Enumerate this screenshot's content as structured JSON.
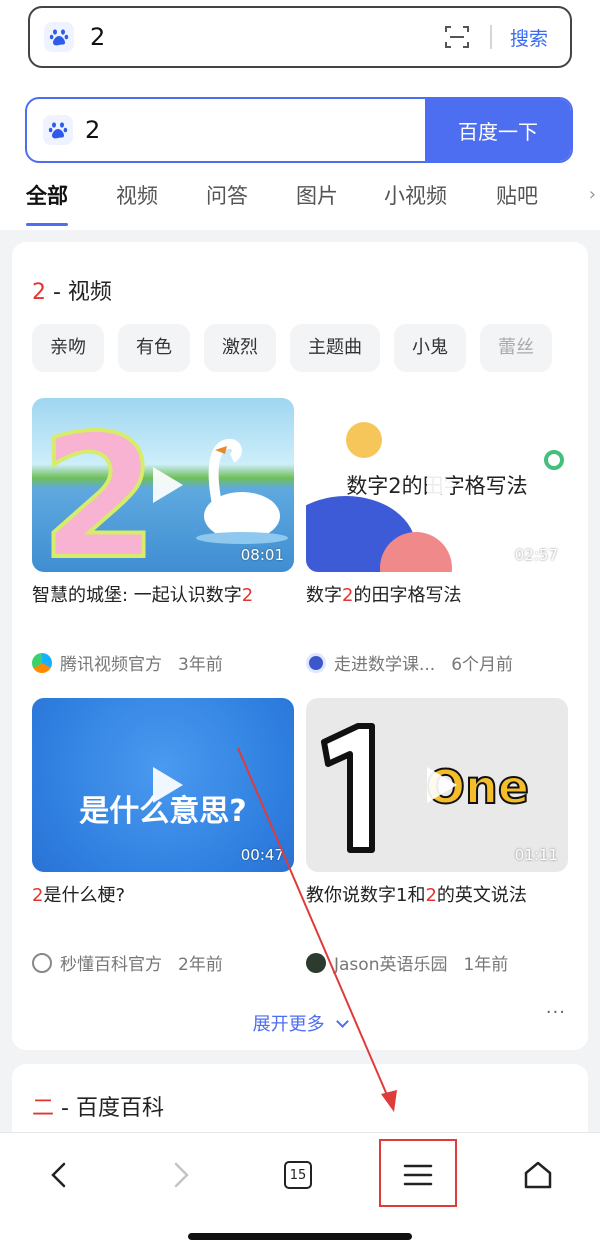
{
  "address_bar": {
    "query": "2",
    "search_label": "搜索"
  },
  "search_box": {
    "value": "2",
    "button_label": "百度一下"
  },
  "tabs": [
    {
      "label": "全部",
      "active": true
    },
    {
      "label": "视频"
    },
    {
      "label": "问答"
    },
    {
      "label": "图片"
    },
    {
      "label": "小视频"
    },
    {
      "label": "贴吧"
    }
  ],
  "video_card": {
    "title_highlight": "2",
    "title_rest": " - 视频",
    "chips": [
      "亲吻",
      "有色",
      "激烈",
      "主题曲",
      "小鬼",
      "蕾丝"
    ],
    "videos": [
      {
        "title_pre": "智慧的城堡: 一起认识数字",
        "title_hl": "2",
        "title_post": "",
        "duration": "08:01",
        "source": "腾讯视频官方",
        "time": "3年前",
        "thumb_text": ""
      },
      {
        "title_pre": "数字",
        "title_hl": "2",
        "title_post": "的田字格写法",
        "duration": "02:57",
        "source": "走进数学课...",
        "time": "6个月前",
        "thumb_text": "数字2的田字格写法"
      },
      {
        "title_pre": "",
        "title_hl": "2",
        "title_post": "是什么梗?",
        "duration": "00:47",
        "source": "秒懂百科官方",
        "time": "2年前",
        "thumb_text": "是什么意思?"
      },
      {
        "title_pre": "教你说数字1和",
        "title_hl": "2",
        "title_post": "的英文说法",
        "duration": "01:11",
        "source": "Jason英语乐园",
        "time": "1年前",
        "thumb_text": "One"
      }
    ],
    "expand_label": "展开更多",
    "more_label": "···"
  },
  "baike_card": {
    "title_highlight": "二",
    "title_rest": " - 百度百科"
  },
  "bottom_nav": {
    "tab_count": "15"
  },
  "colors": {
    "accent": "#4e6ef2",
    "highlight": "#e3342f",
    "annotation": "#e03b3b"
  }
}
